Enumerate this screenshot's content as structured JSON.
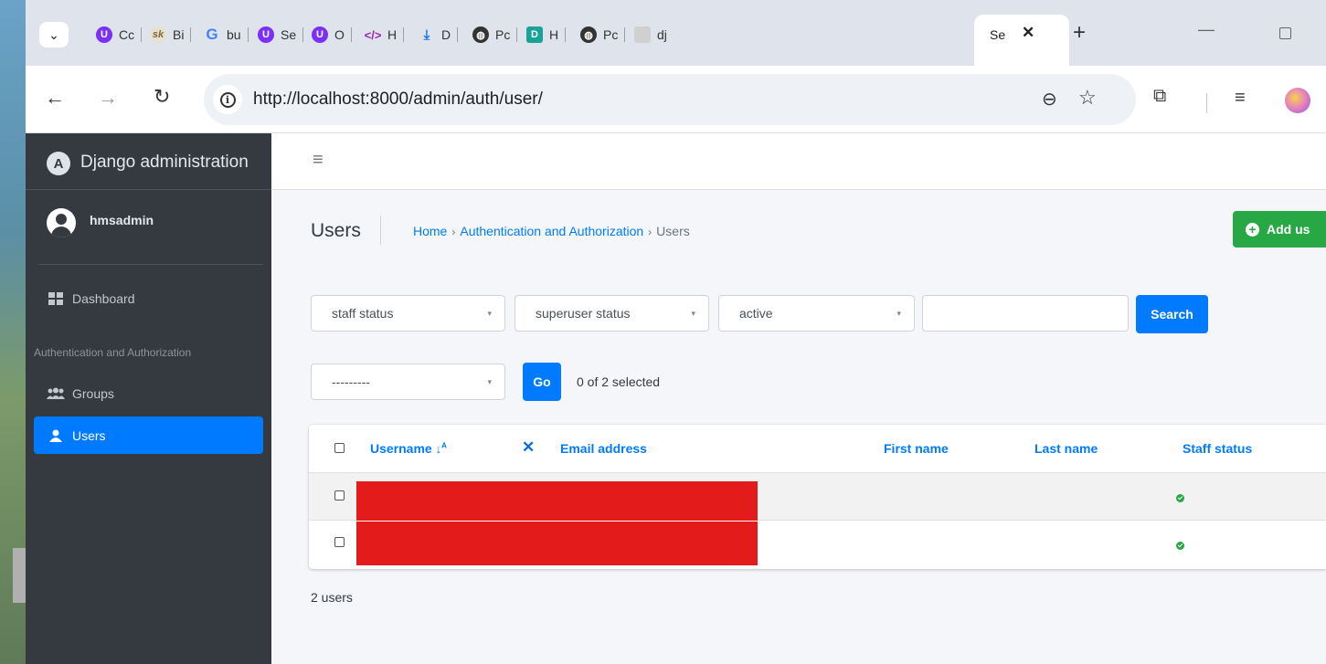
{
  "browser": {
    "tabs": [
      {
        "label": "Cc",
        "favicon": "u-circle-icon",
        "color": "#7b2ff7"
      },
      {
        "label": "Bi",
        "favicon": "sk-logo-icon",
        "color": "#e8e1d0"
      },
      {
        "label": "bu",
        "favicon": "google-icon",
        "color": "#4285f4"
      },
      {
        "label": "Se",
        "favicon": "u-circle-icon",
        "color": "#7b2ff7"
      },
      {
        "label": "O",
        "favicon": "u-circle-icon",
        "color": "#7b2ff7"
      },
      {
        "label": "H",
        "favicon": "code-icon",
        "color": "#9c27b0"
      },
      {
        "label": "D",
        "favicon": "download-icon",
        "color": "#1a73e8"
      },
      {
        "label": "Pc",
        "favicon": "globe-icon",
        "color": "#333333"
      },
      {
        "label": "H",
        "favicon": "d-square-icon",
        "color": "#17a398"
      },
      {
        "label": "Pc",
        "favicon": "globe-icon",
        "color": "#333333"
      },
      {
        "label": "dj",
        "favicon": "cube-icon",
        "color": "#d0d0d0"
      }
    ],
    "active_tab": {
      "label": "Se",
      "close": "✕"
    },
    "new_tab": "+",
    "url": "http://localhost:8000/admin/auth/user/"
  },
  "admin": {
    "brand": "Django administration",
    "brand_logo": "A",
    "user": "hmsadmin",
    "nav": {
      "dashboard": "Dashboard",
      "section_header": "Authentication and Authorization",
      "groups": "Groups",
      "users": "Users"
    },
    "page_title": "Users",
    "breadcrumb": {
      "home": "Home",
      "section": "Authentication and Authorization",
      "current": "Users"
    },
    "add_button": "Add us",
    "filters": {
      "staff": "staff status",
      "superuser": "superuser status",
      "active": "active"
    },
    "search_button": "Search",
    "action_select": "---------",
    "go_button": "Go",
    "selection_counter": "0 of 2 selected",
    "columns": {
      "username": "Username",
      "email": "Email address",
      "first_name": "First name",
      "last_name": "Last name",
      "staff": "Staff status"
    },
    "sort_indicator": "↓",
    "result_count": "2 users",
    "colors": {
      "primary": "#007bff",
      "success": "#28a745",
      "sidebar": "#343a40",
      "redaction": "#e31b1b"
    }
  }
}
